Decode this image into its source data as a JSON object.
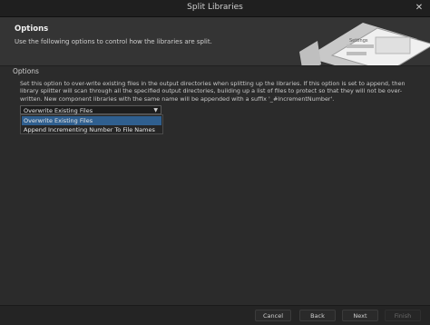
{
  "window": {
    "title": "Split Libraries",
    "close_icon": "close-icon"
  },
  "header": {
    "title": "Options",
    "subtitle": "Use the following options to control how the libraries are split.",
    "art_labels": [
      "Settings"
    ]
  },
  "section": {
    "label": "Options",
    "description": "Set this option to over-write existing files in the output directories when splitting up the libraries. If this option is set to append, then library splitter will scan through all the specified output directories, building up a list of files to protect so that they will not be over-written. New component libraries with the same name will be appended with a suffix '_#IncrementNumber'."
  },
  "dropdown": {
    "selected": "Overwrite Existing Files",
    "options": [
      "Overwrite Existing Files",
      "Append Incrementing Number To File Names"
    ]
  },
  "footer": {
    "cancel": "Cancel",
    "back": "Back",
    "next": "Next",
    "finish": "Finish"
  },
  "colors": {
    "background": "#2b2b2b",
    "header": "#343434",
    "selection": "#2f5f8f"
  }
}
